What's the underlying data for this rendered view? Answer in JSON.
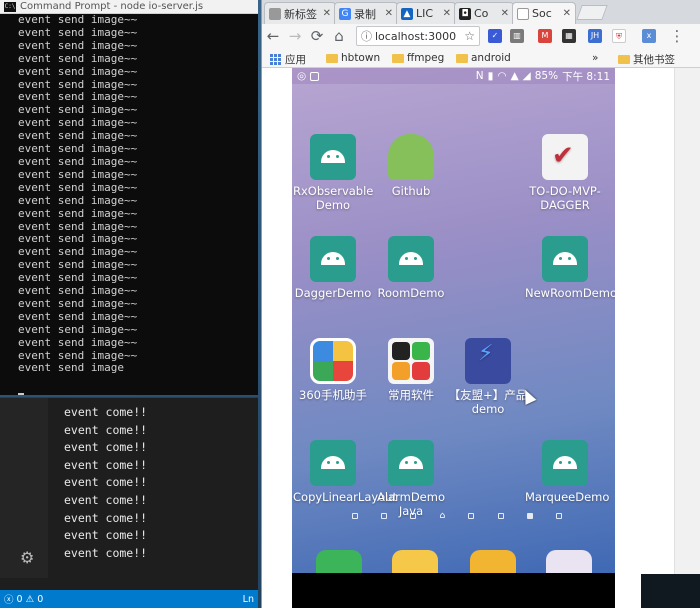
{
  "cmd": {
    "title": "Command Prompt - node io-server.js",
    "icon_label": "C:\\",
    "lines": [
      "event send image~~",
      "event send image~~",
      "event send image~~",
      "event send image~~",
      "event send image~~",
      "event send image~~",
      "event send image~~",
      "event send image~~",
      "event send image~~",
      "event send image~~",
      "event send image~~",
      "event send image~~",
      "event send image~~",
      "event send image~~",
      "event send image~~",
      "event send image~~",
      "event send image~~",
      "event send image~~",
      "event send image~~",
      "event send image~~",
      "event send image~~",
      "event send image~~",
      "event send image~~",
      "event send image~~",
      "event send image~~",
      "event send image~~",
      "event send image~~",
      "event send image"
    ]
  },
  "vscode": {
    "lines": [
      "event come!!",
      "event come!!",
      "event come!!",
      "event come!!",
      "event come!!",
      "event come!!",
      "event come!!",
      "event come!!",
      "event come!!"
    ],
    "status": {
      "errors": "0",
      "warnings": "0",
      "right": "Ln"
    }
  },
  "chrome": {
    "tabs": [
      {
        "label": "新标签",
        "color": "#888"
      },
      {
        "label": "录制",
        "color": "#4285f4"
      },
      {
        "label": "LIC",
        "color": "#1565c0"
      },
      {
        "label": "Co",
        "color": "#222"
      },
      {
        "label": "Soc",
        "color": "#fff"
      }
    ],
    "address": "localhost:3000",
    "bookmarks": [
      {
        "label": "应用",
        "kind": "apps"
      },
      {
        "label": "hbtown",
        "kind": "folder"
      },
      {
        "label": "ffmpeg",
        "kind": "folder"
      },
      {
        "label": "android",
        "kind": "folder"
      },
      {
        "label": "»",
        "kind": "more"
      },
      {
        "label": "其他书签",
        "kind": "folder"
      }
    ],
    "extension_badges": [
      "JH",
      "x"
    ]
  },
  "phone": {
    "status": {
      "battery": "85%",
      "time": "下午 8:11"
    },
    "apps": [
      {
        "label": "RxObservable Demo",
        "icon": "android-icon"
      },
      {
        "label": "Github",
        "icon": "github-icon"
      },
      {
        "label": "TO-DO-MVP-DAGGER",
        "icon": "todo-icon"
      },
      {
        "label": "DaggerDemo",
        "icon": "android-icon"
      },
      {
        "label": "RoomDemo",
        "icon": "android-icon"
      },
      {
        "label": "NewRoomDemo",
        "icon": "android-icon"
      },
      {
        "label": "360手机助手",
        "icon": "360-icon"
      },
      {
        "label": "常用软件",
        "icon": "folder-icon"
      },
      {
        "label": "【友盟+】产品demo",
        "icon": "umeng-icon"
      },
      {
        "label": "CopyLinearLayout",
        "icon": "android-icon"
      },
      {
        "label": "AlarmDemo Java",
        "icon": "android-icon"
      },
      {
        "label": "MarqueeDemo",
        "icon": "android-icon"
      }
    ]
  }
}
